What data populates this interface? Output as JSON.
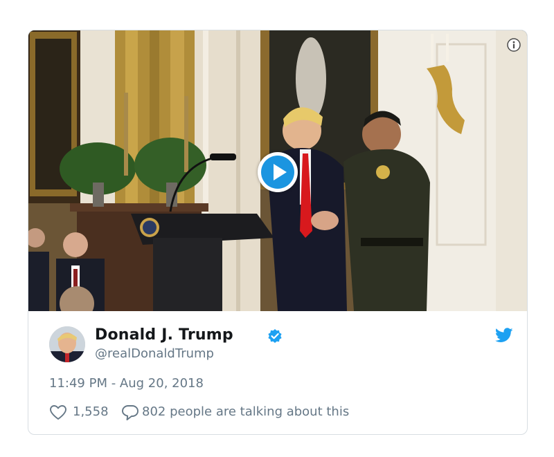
{
  "tweet": {
    "author_name": "Donald J. Trump",
    "author_handle": "@realDonaldTrump",
    "timestamp": "11:49 PM - Aug 20, 2018",
    "likes_count": "1,558",
    "conversation_text": "802 people are talking about this"
  },
  "icons": {
    "play": "play-icon",
    "info": "info-icon",
    "verified": "verified-badge-icon",
    "brand": "twitter-bird-icon",
    "like": "heart-icon",
    "reply": "speech-bubble-icon"
  },
  "colors": {
    "accent": "#1b95e0",
    "name": "#14171a",
    "secondary": "#657786",
    "border": "#d7dde2"
  }
}
